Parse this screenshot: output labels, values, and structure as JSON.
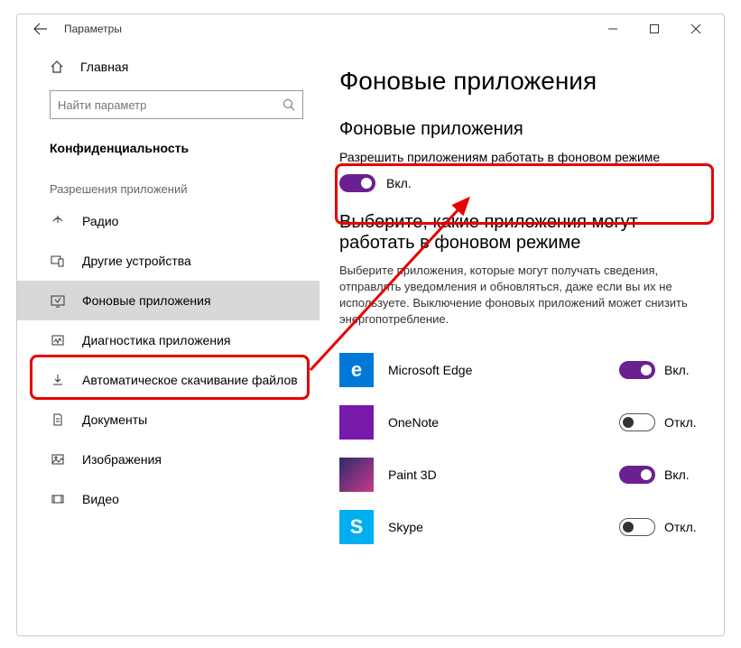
{
  "titlebar": {
    "title": "Параметры"
  },
  "sidebar": {
    "home": "Главная",
    "search_placeholder": "Найти параметр",
    "category": "Конфиденциальность",
    "section": "Разрешения приложений",
    "items": [
      {
        "label": "Радио"
      },
      {
        "label": "Другие устройства"
      },
      {
        "label": "Фоновые приложения"
      },
      {
        "label": "Диагностика приложения"
      },
      {
        "label": "Автоматическое скачивание файлов"
      },
      {
        "label": "Документы"
      },
      {
        "label": "Изображения"
      },
      {
        "label": "Видео"
      }
    ]
  },
  "main": {
    "h1": "Фоновые приложения",
    "h2a": "Фоновые приложения",
    "allow_label": "Разрешить приложениям работать в фоновом режиме",
    "allow_state": "Вкл.",
    "h2b": "Выберите, какие приложения могут работать в фоновом режиме",
    "desc": "Выберите приложения, которые могут получать сведения, отправлять уведомления и обновляться, даже если вы их не используете. Выключение фоновых приложений может снизить энергопотребление.",
    "apps": [
      {
        "name": "Microsoft Edge",
        "state": "Вкл.",
        "color": "#0078d7",
        "letter": "e",
        "on": true
      },
      {
        "name": "OneNote",
        "state": "Откл.",
        "color": "#7719aa",
        "letter": "",
        "on": false
      },
      {
        "name": "Paint 3D",
        "state": "Вкл.",
        "color": "#2b2b6b",
        "letter": "",
        "on": true
      },
      {
        "name": "Skype",
        "state": "Откл.",
        "color": "#00aff0",
        "letter": "S",
        "on": false
      }
    ]
  }
}
